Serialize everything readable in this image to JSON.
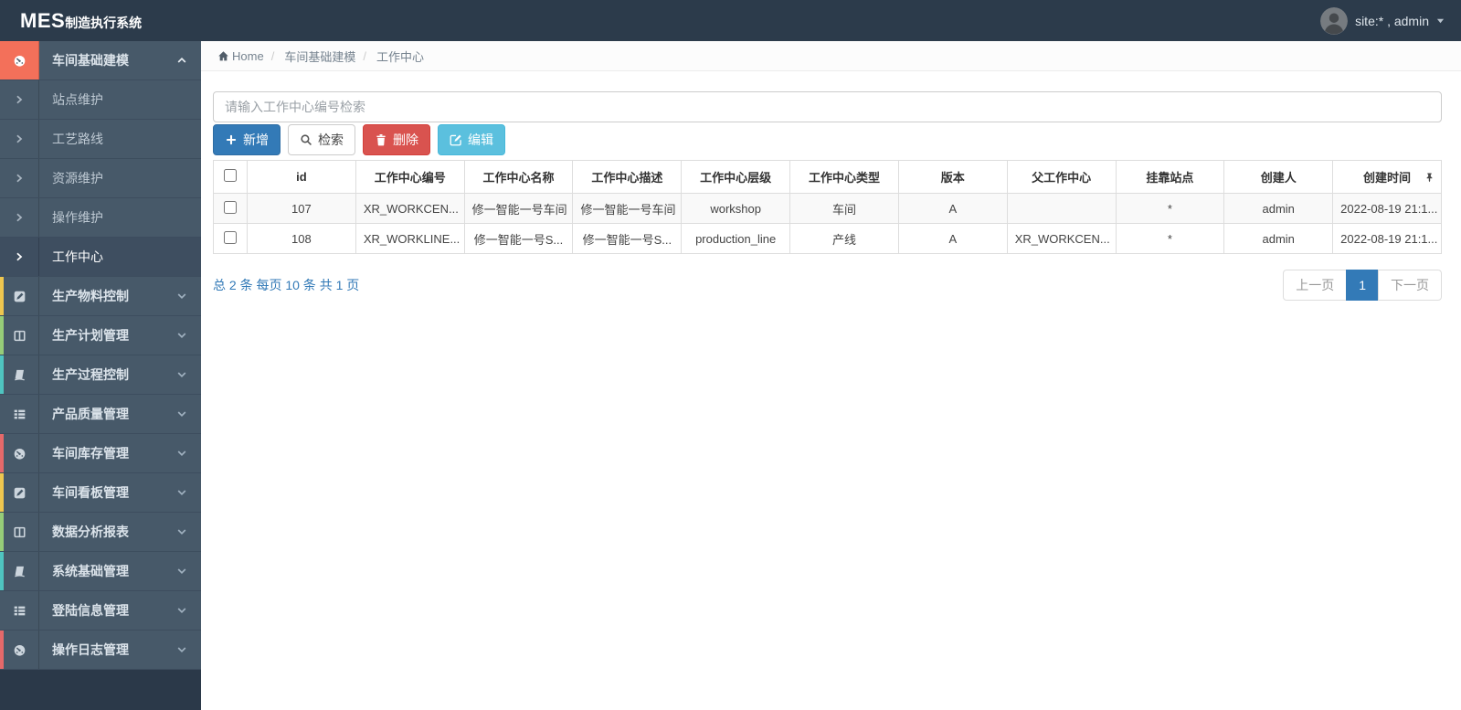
{
  "app": {
    "brand_bold": "MES",
    "brand_rest": "制造执行系统"
  },
  "topbar": {
    "user_label": "site:* , admin"
  },
  "breadcrumb": {
    "items": [
      "Home",
      "车间基础建模",
      "工作中心"
    ]
  },
  "sidebar": {
    "sections": [
      {
        "label": "车间基础建模",
        "icon": "gauge-icon",
        "active": true,
        "chevron": "up",
        "children": [
          {
            "label": "站点维护"
          },
          {
            "label": "工艺路线"
          },
          {
            "label": "资源维护"
          },
          {
            "label": "操作维护"
          },
          {
            "label": "工作中心",
            "active": true
          }
        ]
      },
      {
        "label": "生产物料控制",
        "icon": "edit-icon",
        "strip": "#eec64f",
        "chevron": "down"
      },
      {
        "label": "生产计划管理",
        "icon": "columns-icon",
        "strip": "#96cc78",
        "chevron": "down"
      },
      {
        "label": "生产过程控制",
        "icon": "book-icon",
        "strip": "#4fc4c0",
        "chevron": "down"
      },
      {
        "label": "产品质量管理",
        "icon": "list-icon",
        "strip": "",
        "chevron": "down"
      },
      {
        "label": "车间库存管理",
        "icon": "gauge-icon",
        "strip": "#e5696a",
        "chevron": "down"
      },
      {
        "label": "车间看板管理",
        "icon": "edit-icon",
        "strip": "#eec64f",
        "chevron": "down"
      },
      {
        "label": "数据分析报表",
        "icon": "columns-icon",
        "strip": "#96cc78",
        "chevron": "down"
      },
      {
        "label": "系统基础管理",
        "icon": "book-icon",
        "strip": "#4fc4c0",
        "chevron": "down"
      },
      {
        "label": "登陆信息管理",
        "icon": "list-icon",
        "strip": "",
        "chevron": "down"
      },
      {
        "label": "操作日志管理",
        "icon": "gauge-icon",
        "strip": "#e5696a",
        "chevron": "down"
      }
    ]
  },
  "search": {
    "placeholder": "请输入工作中心编号检索"
  },
  "toolbar": {
    "add": "新增",
    "search": "检索",
    "delete": "删除",
    "edit": "编辑"
  },
  "table": {
    "columns": [
      "id",
      "工作中心编号",
      "工作中心名称",
      "工作中心描述",
      "工作中心层级",
      "工作中心类型",
      "版本",
      "父工作中心",
      "挂靠站点",
      "创建人",
      "创建时间"
    ],
    "rows": [
      [
        "107",
        "XR_WORKCEN...",
        "修一智能一号车间",
        "修一智能一号车间",
        "workshop",
        "车间",
        "A",
        "",
        "*",
        "admin",
        "2022-08-19 21:1..."
      ],
      [
        "108",
        "XR_WORKLINE...",
        "修一智能一号S...",
        "修一智能一号S...",
        "production_line",
        "产线",
        "A",
        "XR_WORKCEN...",
        "*",
        "admin",
        "2022-08-19 21:1..."
      ]
    ]
  },
  "pagination": {
    "summary": "总 2 条 每页 10 条 共 1 页",
    "prev": "上一页",
    "page": "1",
    "next": "下一页"
  },
  "colors": {
    "accent_active": "#f3705a",
    "primary": "#337ab7",
    "danger": "#d9534f",
    "info": "#5bc0de",
    "topbar_bg": "#2c3b4b",
    "sidebar_bg": "#475969"
  }
}
